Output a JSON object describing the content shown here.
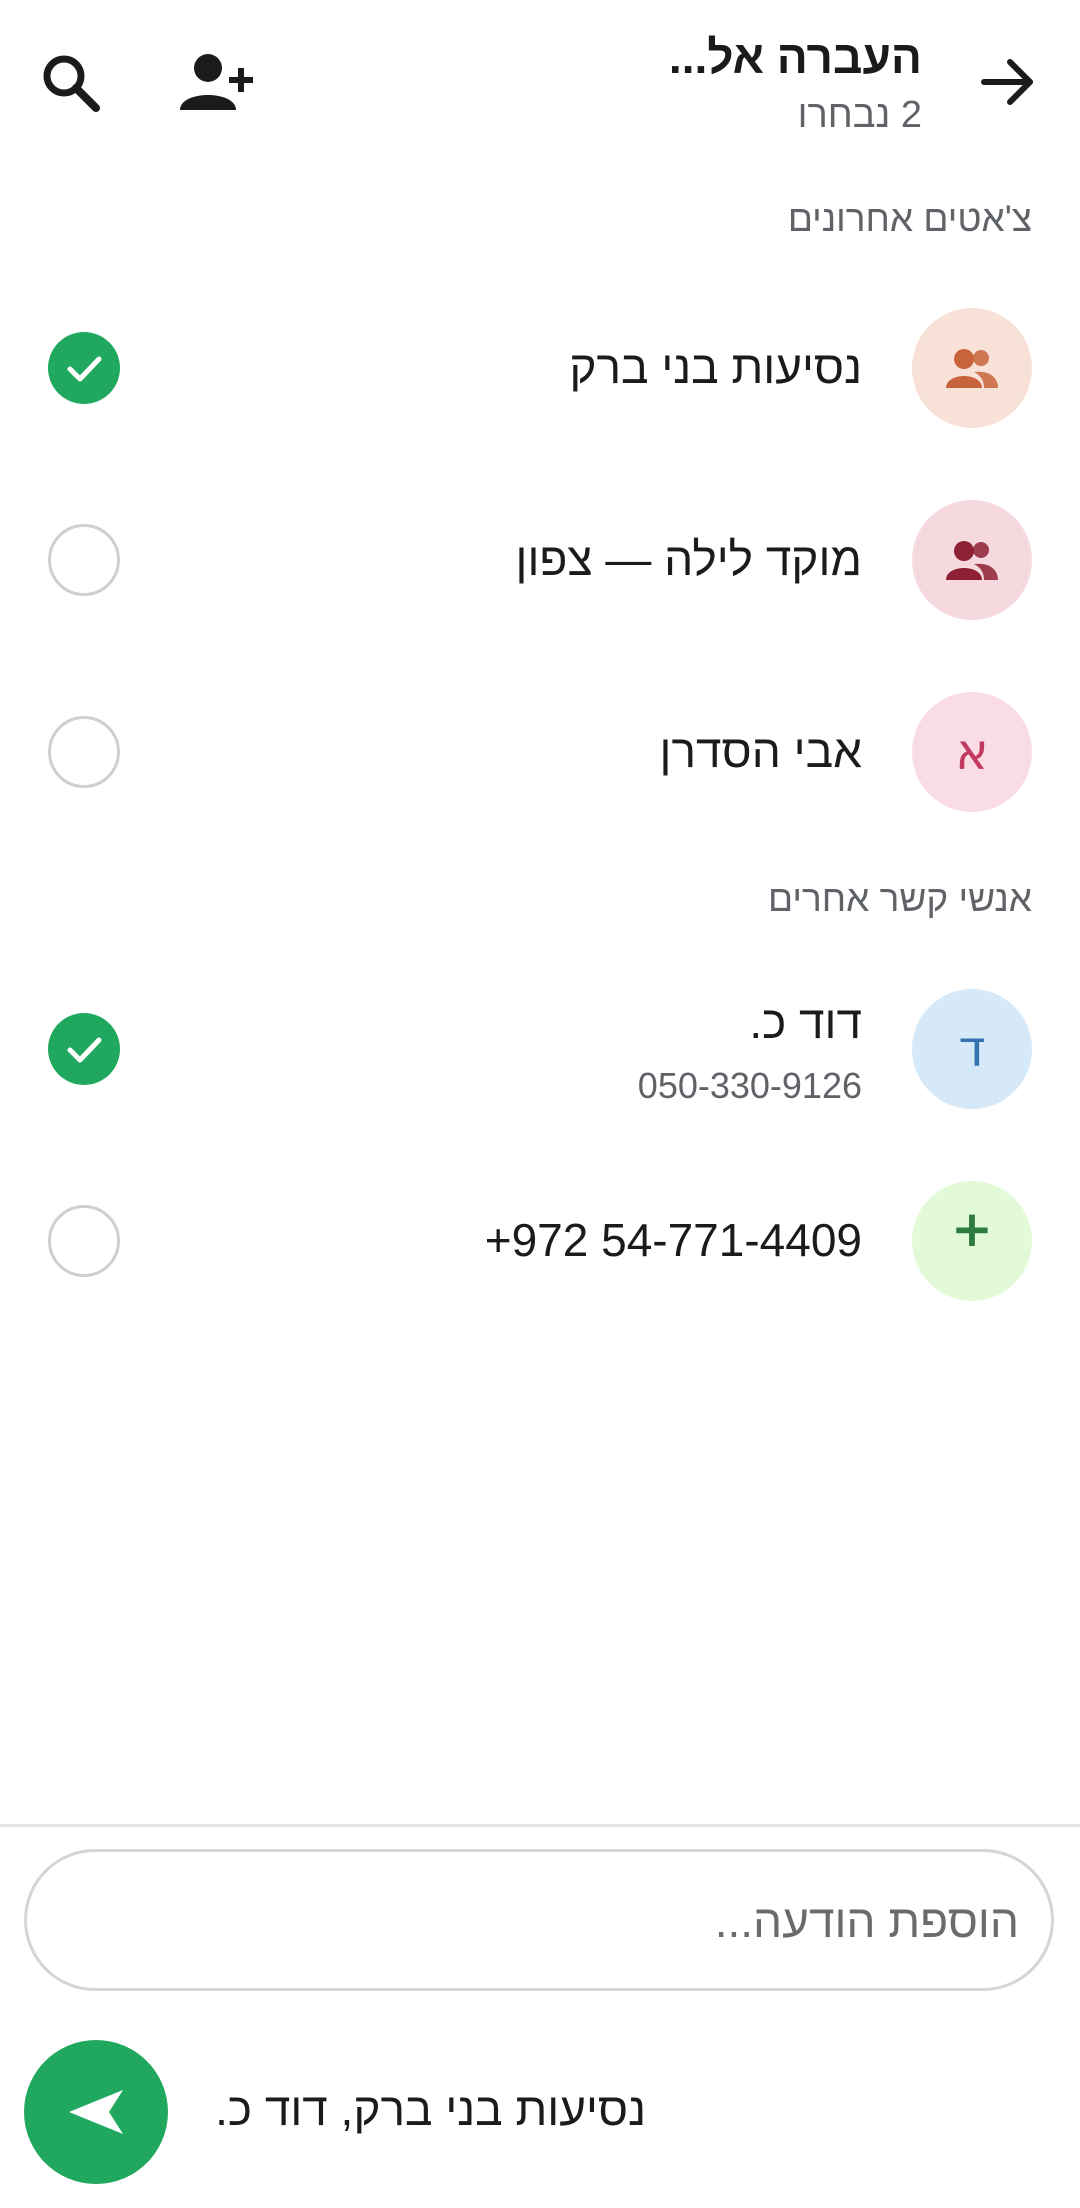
{
  "header": {
    "title": "העברה אל...",
    "subtitle": "2 נבחרו",
    "back_icon": "arrow-right-icon",
    "add_contact_icon": "person-add-icon",
    "search_icon": "search-icon"
  },
  "sections": {
    "recent_label": "צ'אטים אחרונים",
    "other_label": "אנשי קשר אחרים"
  },
  "recent_chats": [
    {
      "name": "נסיעות בני ברק",
      "avatar": "group-icon",
      "avatar_bg": "#f8e1d6",
      "avatar_fg": "#c8643c",
      "selected": true
    },
    {
      "name": "מוקד לילה — צפון",
      "avatar": "group-icon",
      "avatar_bg": "#f6d9de",
      "avatar_fg": "#8e2036",
      "selected": false
    },
    {
      "name": "אבי הסדרן",
      "avatar_letter": "א",
      "avatar_bg": "#f9dce6",
      "avatar_fg": "#c23a62",
      "selected": false
    }
  ],
  "other_contacts": [
    {
      "name": "דוד כ.",
      "phone": "050-330-9126",
      "avatar_letter": "ד",
      "avatar_bg": "#d5e9f8",
      "avatar_fg": "#3573b0",
      "selected": true
    },
    {
      "name": "+972 54-771-4409",
      "avatar_letter": "+",
      "avatar_bg": "#e2fad8",
      "avatar_fg": "#2f7b3f",
      "selected": false
    }
  ],
  "compose": {
    "placeholder": "הוספת הודעה...",
    "value": "",
    "recipients": "נסיעות בני ברק, דוד כ.",
    "send_icon": "send-icon"
  },
  "colors": {
    "accent": "#21a85f",
    "unselected_border": "#cfcfcf"
  }
}
